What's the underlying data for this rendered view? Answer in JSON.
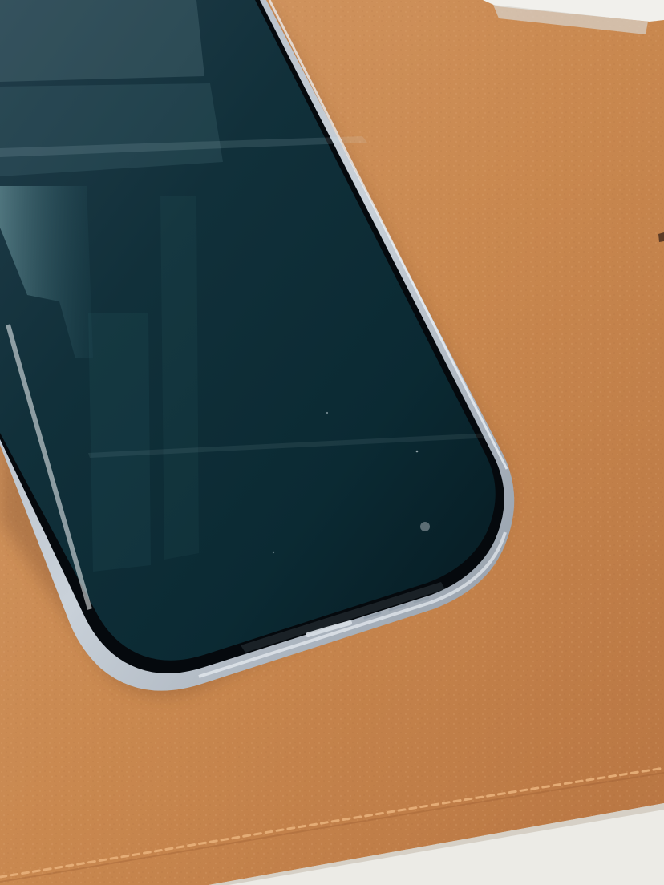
{
  "scene": {
    "description_free": true,
    "colors": {
      "leather_light": "#d39762",
      "leather_mid": "#c4824d",
      "leather_dark": "#a96736",
      "stitch": "#e7b07b",
      "phone_frame": "#b7c0ca",
      "phone_frame_highlight": "#e6edf3",
      "phone_screen_dark": "#0d2a33",
      "phone_screen_mid": "#1b4a55",
      "reflection": "#4f7f88",
      "box_white": "#f2f1ee",
      "paper_white": "#ecebe6"
    },
    "objects": {
      "phone": "smartphone",
      "desk_mat": "leather-desk-mat",
      "box": "white-box",
      "paper": "white-paper"
    }
  }
}
